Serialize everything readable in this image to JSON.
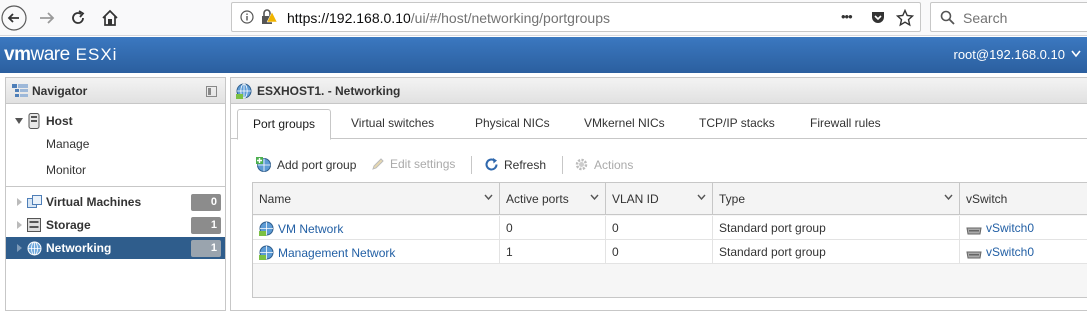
{
  "browser": {
    "url_host": "https://192.168.0.10",
    "url_rest": "/ui/#/host/networking/portgroups",
    "search_placeholder": "Search",
    "more_label": "•••"
  },
  "header": {
    "brand_vm": "vm",
    "brand_ware": "ware",
    "brand_product": "ESXi",
    "user": "root@192.168.0.10"
  },
  "navigator": {
    "title": "Navigator",
    "host_label": "Host",
    "manage_label": "Manage",
    "monitor_label": "Monitor",
    "items": [
      {
        "label": "Virtual Machines",
        "count": "0"
      },
      {
        "label": "Storage",
        "count": "1"
      },
      {
        "label": "Networking",
        "count": "1"
      }
    ]
  },
  "main": {
    "title": "ESXHOST1. - Networking",
    "tabs": [
      "Port groups",
      "Virtual switches",
      "Physical NICs",
      "VMkernel NICs",
      "TCP/IP stacks",
      "Firewall rules"
    ],
    "toolbar": {
      "add": "Add port group",
      "edit": "Edit settings",
      "refresh": "Refresh",
      "actions": "Actions"
    },
    "columns": [
      "Name",
      "Active ports",
      "VLAN ID",
      "Type",
      "vSwitch"
    ],
    "rows": [
      {
        "name": "VM Network",
        "active_ports": "0",
        "vlan": "0",
        "type": "Standard port group",
        "vswitch": "vSwitch0"
      },
      {
        "name": "Management Network",
        "active_ports": "1",
        "vlan": "0",
        "type": "Standard port group",
        "vswitch": "vSwitch0"
      }
    ]
  },
  "colors": {
    "header_blue": "#2f68ad",
    "selected_nav": "#2f5d8c",
    "link": "#2360a5"
  }
}
